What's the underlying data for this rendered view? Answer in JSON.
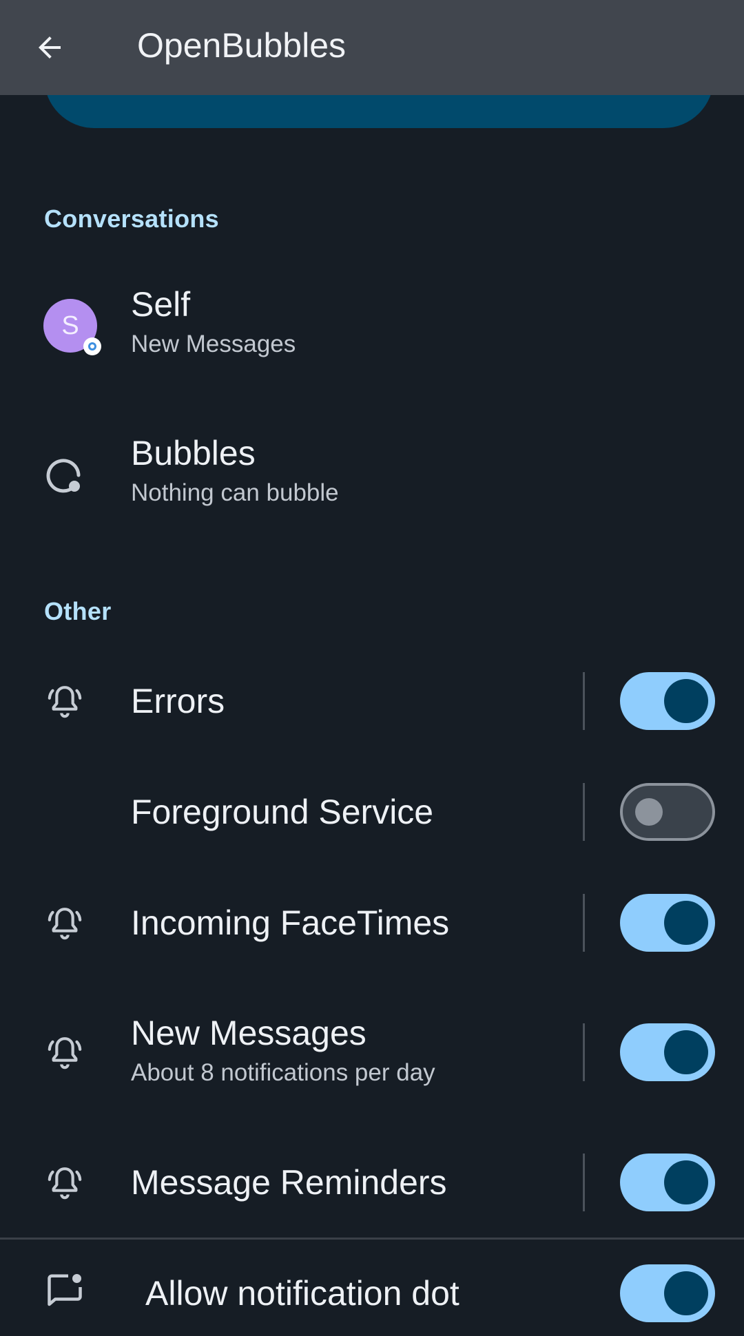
{
  "app_bar": {
    "title": "OpenBubbles"
  },
  "sections": {
    "conversations": "Conversations",
    "other": "Other"
  },
  "conversations": {
    "self": {
      "avatar_letter": "S",
      "title": "Self",
      "subtitle": "New Messages"
    },
    "bubbles": {
      "title": "Bubbles",
      "subtitle": "Nothing can bubble"
    }
  },
  "channels": {
    "errors": {
      "title": "Errors",
      "enabled": true
    },
    "foreground": {
      "title": "Foreground Service",
      "enabled": false
    },
    "facetimes": {
      "title": "Incoming FaceTimes",
      "enabled": true
    },
    "new_messages": {
      "title": "New Messages",
      "subtitle": "About 8 notifications per day",
      "enabled": true
    },
    "reminders": {
      "title": "Message Reminders",
      "enabled": true
    }
  },
  "notification_dot": {
    "title": "Allow notification dot",
    "enabled": true
  },
  "colors": {
    "background": "#161d25",
    "app_bar": "#41464e",
    "accent": "#8fcdfd",
    "section_header": "#b5e1fb",
    "banner": "#014a6c"
  }
}
